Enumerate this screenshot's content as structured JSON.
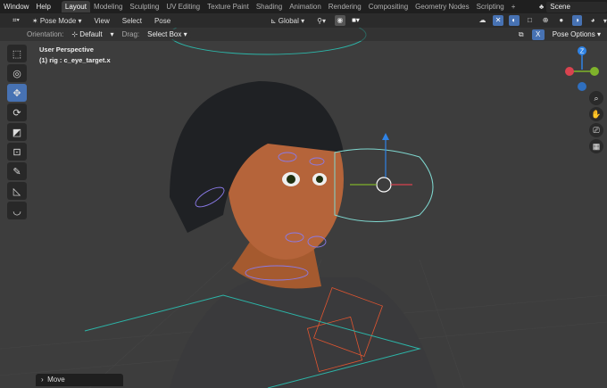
{
  "menus": [
    "Window",
    "Help"
  ],
  "workspaces": [
    {
      "label": "Layout",
      "active": true
    },
    {
      "label": "Modeling"
    },
    {
      "label": "Sculpting"
    },
    {
      "label": "UV Editing"
    },
    {
      "label": "Texture Paint"
    },
    {
      "label": "Shading"
    },
    {
      "label": "Animation"
    },
    {
      "label": "Rendering"
    },
    {
      "label": "Compositing"
    },
    {
      "label": "Geometry Nodes"
    },
    {
      "label": "Scripting"
    }
  ],
  "add_tab": "+",
  "scene": "Scene",
  "header": {
    "mode": "Pose Mode",
    "view": "View",
    "select": "Select",
    "pose": "Pose",
    "orientation": "Global"
  },
  "tool_settings": {
    "orientation_label": "Orientation:",
    "orientation_value": "Default",
    "drag_label": "Drag:",
    "drag_value": "Select Box",
    "mirror_x": "X",
    "pose_options": "Pose Options"
  },
  "viewport": {
    "perspective": "User Perspective",
    "active_object": "(1) rig : c_eye_target.x"
  },
  "gizmo": {
    "z_label": "Z",
    "colors": {
      "x": "#d9434f",
      "y": "#7fb32b",
      "z": "#2f83e6"
    }
  },
  "last_operator": "Move",
  "accent": "#4772b3"
}
